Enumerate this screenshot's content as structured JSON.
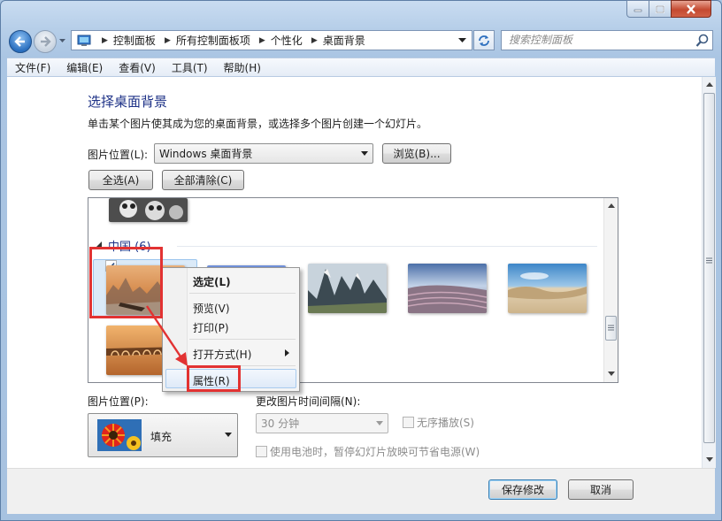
{
  "window": {
    "address": [
      "控制面板",
      "所有控制面板项",
      "个性化",
      "桌面背景"
    ],
    "search_placeholder": "搜索控制面板"
  },
  "menu": [
    "文件(F)",
    "编辑(E)",
    "查看(V)",
    "工具(T)",
    "帮助(H)"
  ],
  "main": {
    "title": "选择桌面背景",
    "subtitle": "单击某个图片使其成为您的桌面背景，或选择多个图片创建一个幻灯片。",
    "location_label": "图片位置(L):",
    "location_value": "Windows 桌面背景",
    "browse_label": "浏览(B)...",
    "select_all_label": "全选(A)",
    "clear_all_label": "全部清除(C)",
    "group_label": "中国 (6)"
  },
  "context_menu": {
    "items": [
      "选定(L)",
      "预览(V)",
      "打印(P)",
      "打开方式(H)",
      "属性(R)"
    ]
  },
  "options": {
    "position_label": "图片位置(P):",
    "position_value": "填充",
    "interval_label": "更改图片时间间隔(N):",
    "interval_value": "30 分钟",
    "shuffle_label": "无序播放(S)",
    "battery_label": "使用电池时，暂停幻灯片放映可节省电源(W)"
  },
  "footer": {
    "save_label": "保存修改",
    "cancel_label": "取消"
  },
  "colors": {
    "title_blue": "#1e3287",
    "highlight_red": "#e23232",
    "frame_blue": "#a9c4e2"
  }
}
